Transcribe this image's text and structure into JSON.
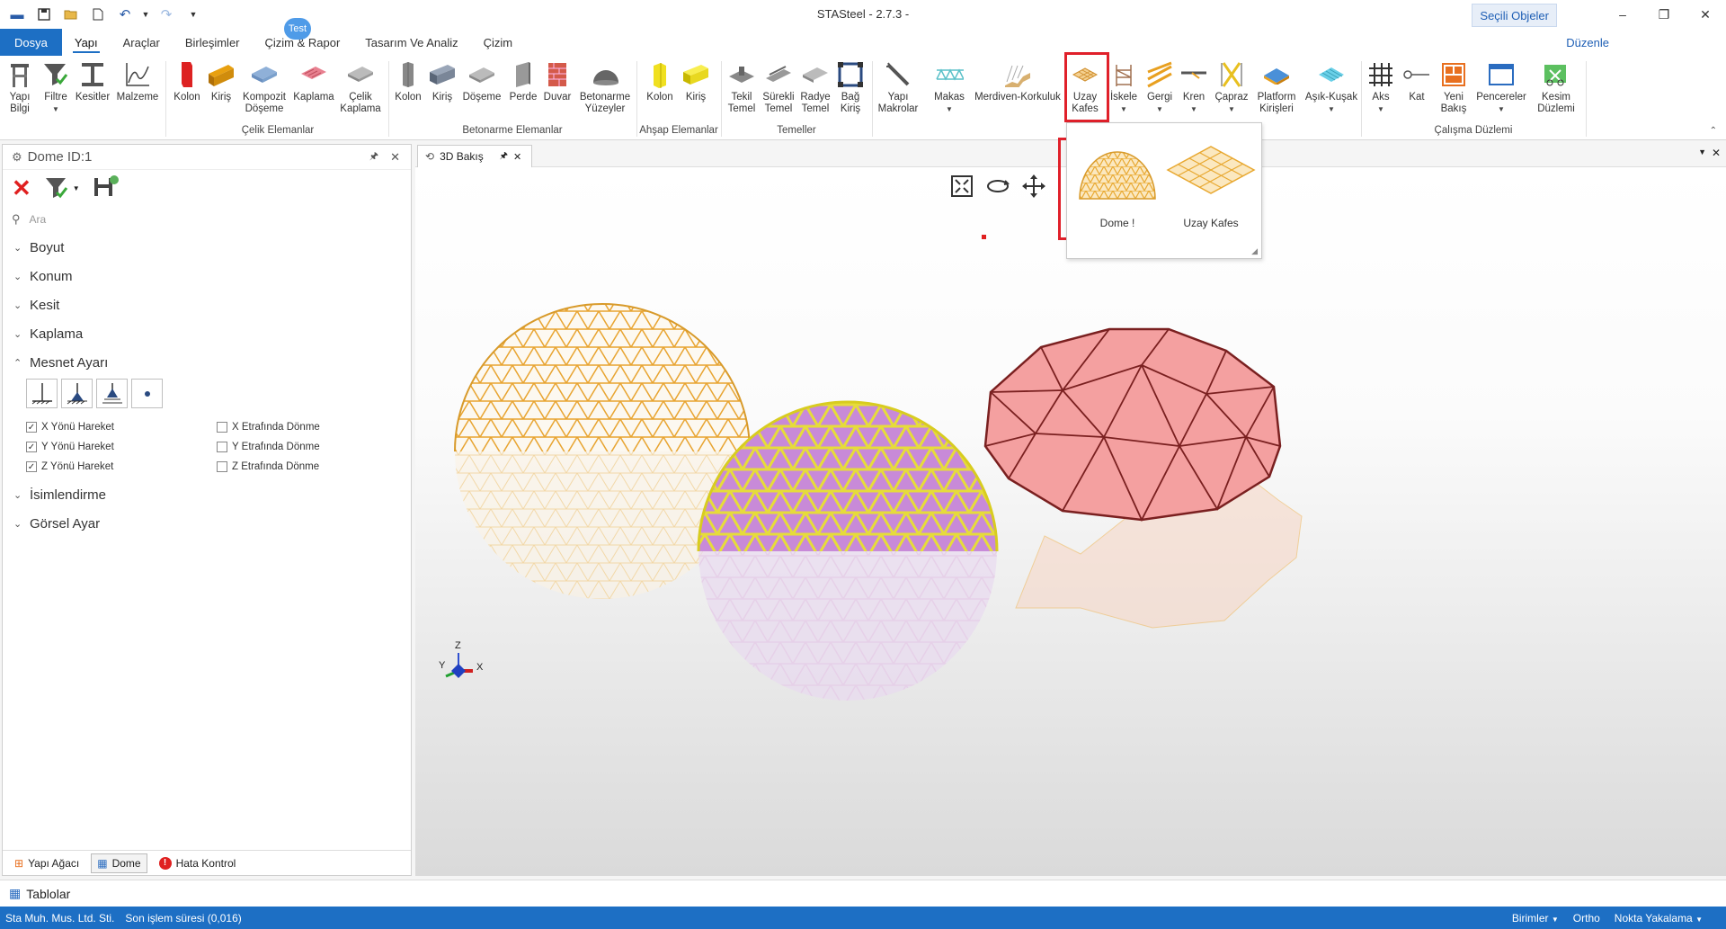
{
  "window": {
    "title": "STASteel - 2.7.3 -",
    "selected_objects": "Seçili Objeler",
    "minimize": "–",
    "restore": "❐",
    "close": "✕"
  },
  "menu": {
    "tabs": [
      "Dosya",
      "Yapı",
      "Araçlar",
      "Birleşimler",
      "Çizim & Rapor",
      "Tasarım Ve Analiz",
      "Çizim"
    ],
    "badge": "Test",
    "edit": "Düzenle"
  },
  "ribbon": {
    "yapi_bilgi": [
      "Yapı",
      "Bilgi"
    ],
    "filtre": "Filtre",
    "kesitler": "Kesitler",
    "malzeme": "Malzeme",
    "celik": {
      "kolon": "Kolon",
      "kiris": "Kiriş",
      "kompozit": [
        "Kompozit",
        "Döşeme"
      ],
      "kaplama": "Kaplama",
      "celik_kaplama": [
        "Çelik",
        "Kaplama"
      ],
      "group": "Çelik Elemanlar"
    },
    "betonarme": {
      "kolon": "Kolon",
      "kiris": "Kiriş",
      "doseme": "Döşeme",
      "perde": "Perde",
      "duvar": "Duvar",
      "yuzeyler": [
        "Betonarme",
        "Yüzeyler"
      ],
      "group": "Betonarme Elemanlar"
    },
    "ahsap": {
      "kolon": "Kolon",
      "kiris": "Kiriş",
      "group": "Ahşap Elemanlar"
    },
    "temeller": {
      "tekil": [
        "Tekil",
        "Temel"
      ],
      "surekli": [
        "Sürekli",
        "Temel"
      ],
      "radye": [
        "Radye",
        "Temel"
      ],
      "bag": [
        "Bağ",
        "Kiriş"
      ],
      "group": "Temeller"
    },
    "diger": {
      "makrolar": [
        "Yapı",
        "Makrolar"
      ],
      "makas": "Makas",
      "merdiven": "Merdiven-Korkuluk",
      "uzay": [
        "Uzay",
        "Kafes"
      ],
      "iskele": "İskele",
      "gergi": "Gergi",
      "kren": "Kren",
      "capraz": "Çapraz",
      "platform": [
        "Platform",
        "Kirişleri"
      ],
      "asik": "Aşık-Kuşak"
    },
    "calisma": {
      "aks": "Aks",
      "kat": "Kat",
      "yeni": [
        "Yeni",
        "Bakış"
      ],
      "pencereler": "Pencereler",
      "kesim": [
        "Kesim",
        "Düzlemi"
      ],
      "group": "Çalışma Düzlemi"
    }
  },
  "left_panel": {
    "title": "Dome ID:1",
    "search_placeholder": "Ara",
    "sections": [
      "Boyut",
      "Konum",
      "Kesit",
      "Kaplama",
      "Mesnet Ayarı",
      "İsimlendirme",
      "Görsel Ayar"
    ],
    "checks": [
      {
        "label": "X Yönü Hareket",
        "checked": true
      },
      {
        "label": "Y Yönü Hareket",
        "checked": true
      },
      {
        "label": "Z Yönü Hareket",
        "checked": true
      },
      {
        "label": "X Etrafında Dönme",
        "checked": false
      },
      {
        "label": "Y Etrafında Dönme",
        "checked": false
      },
      {
        "label": "Z Etrafında Dönme",
        "checked": false
      }
    ],
    "bottom_tabs": [
      "Yapı Ağacı",
      "Dome",
      "Hata Kontrol"
    ]
  },
  "view": {
    "tab": "3D Bakış",
    "axes": {
      "z": "Z",
      "y": "Y",
      "x": "X"
    }
  },
  "popup": {
    "items": [
      "Dome !",
      "Uzay Kafes"
    ]
  },
  "tablolar": "Tablolar",
  "status": {
    "company": "Sta Muh. Mus. Ltd. Sti.",
    "last_op": "Son işlem süresi (0,016)",
    "units": "Birimler",
    "ortho": "Ortho",
    "snap": "Nokta Yakalama"
  },
  "colors": {
    "accent": "#1d6fc4",
    "highlight": "#e0202a",
    "dome_gold": "#f0a830",
    "dome_yellow": "#e8d820",
    "dome_red": "#f08a8a"
  }
}
